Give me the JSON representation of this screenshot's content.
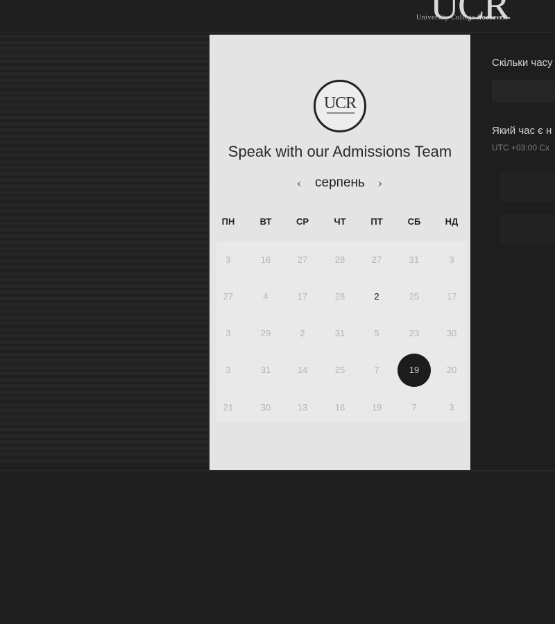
{
  "header": {
    "logo_mark": "UCR",
    "logo_sub_a": "University College ",
    "logo_sub_b": "Roosevelt"
  },
  "card": {
    "logo_text": "UCR",
    "title": "Speak with our Admissions Team",
    "month": "серпень",
    "prev_icon": "chevron-left-icon",
    "next_icon": "chevron-right-icon",
    "weekdays": [
      "ПН",
      "ВТ",
      "СР",
      "ЧТ",
      "ПТ",
      "СБ",
      "НД"
    ],
    "weeks": [
      [
        "3",
        "16",
        "27",
        "28",
        "27",
        "31",
        "3"
      ],
      [
        "27",
        "4",
        "17",
        "28",
        "2",
        "25",
        "17"
      ],
      [
        "3",
        "29",
        "2",
        "31",
        "5",
        "23",
        "30"
      ],
      [
        "3",
        "31",
        "14",
        "25",
        "7",
        "19",
        "20"
      ],
      [
        "21",
        "30",
        "13",
        "16",
        "19",
        "7",
        "3"
      ]
    ],
    "available": [
      [
        1,
        4
      ]
    ],
    "selected": [
      3,
      5
    ]
  },
  "form": {
    "question_duration": "Скільки часу",
    "question_time": "Який час є н",
    "timezone": "UTC +03:00 Сх"
  }
}
